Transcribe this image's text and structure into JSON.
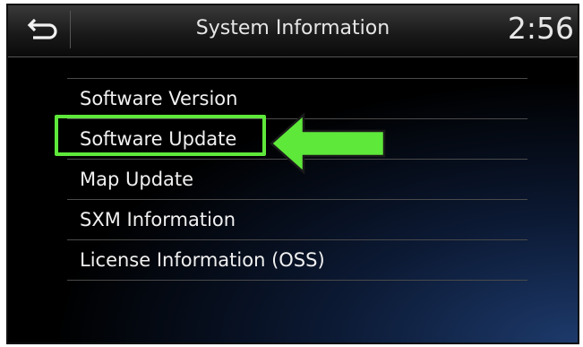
{
  "header": {
    "back_icon": "return-arrow-icon",
    "title": "System Information",
    "clock": "2:56"
  },
  "menu": {
    "items": [
      {
        "label": "Software Version"
      },
      {
        "label": "Software Update",
        "highlighted": true
      },
      {
        "label": "Map Update"
      },
      {
        "label": "SXM Information"
      },
      {
        "label": "License Information (OSS)"
      }
    ]
  },
  "annotation": {
    "callout_icon": "green-arrow-icon",
    "color": "#5ee83a"
  }
}
